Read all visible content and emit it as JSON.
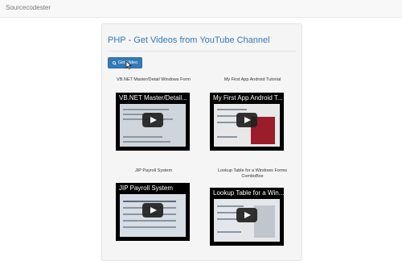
{
  "navbar": {
    "brand": "Sourcecodester"
  },
  "page": {
    "title": "PHP - Get Videos from YouTube Channel"
  },
  "button": {
    "label": "Get Video",
    "icon": "search-icon"
  },
  "videos": [
    {
      "label": "VB.NET Master/Detail Windows Form",
      "thumb_title": "VB.NET Master/Detail..."
    },
    {
      "label": "My First App Android Tutorial",
      "thumb_title": "My First App Android T..."
    },
    {
      "label": "JIP Payroll System",
      "thumb_title": "JIP Payroll System"
    },
    {
      "label": "Lookup Table for a Windows Forms ComboBox",
      "thumb_title": "Lookup Table for a Win..."
    }
  ],
  "colors": {
    "accent": "#337ab7",
    "background": "#f5f5f5"
  }
}
